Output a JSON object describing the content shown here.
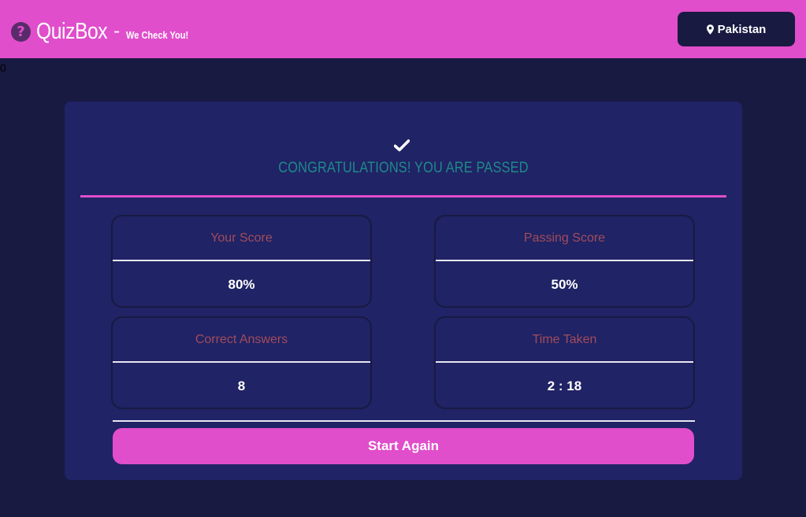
{
  "header": {
    "brand_icon": "question-circle-icon",
    "brand_icon_glyph": "?",
    "title": "QuizBox",
    "separator": "-",
    "tagline": "We Check You!",
    "location_icon": "map-pin-icon",
    "location": "Pakistan"
  },
  "stray_text": "0",
  "result": {
    "status_icon": "check-icon",
    "headline": "CONGRATULATIONS! YOU ARE PASSED",
    "stats": [
      {
        "label": "Your Score",
        "value": "80%"
      },
      {
        "label": "Passing Score",
        "value": "50%"
      },
      {
        "label": "Correct Answers",
        "value": "8"
      },
      {
        "label": "Time Taken",
        "value": "2 : 18"
      }
    ],
    "start_again_label": "Start Again"
  },
  "colors": {
    "header_bg": "#e04ecb",
    "page_bg": "#181a41",
    "card_bg": "#202365",
    "headline": "#1f8a8a",
    "stat_label": "#a14c5c",
    "accent": "#e04ecb"
  }
}
